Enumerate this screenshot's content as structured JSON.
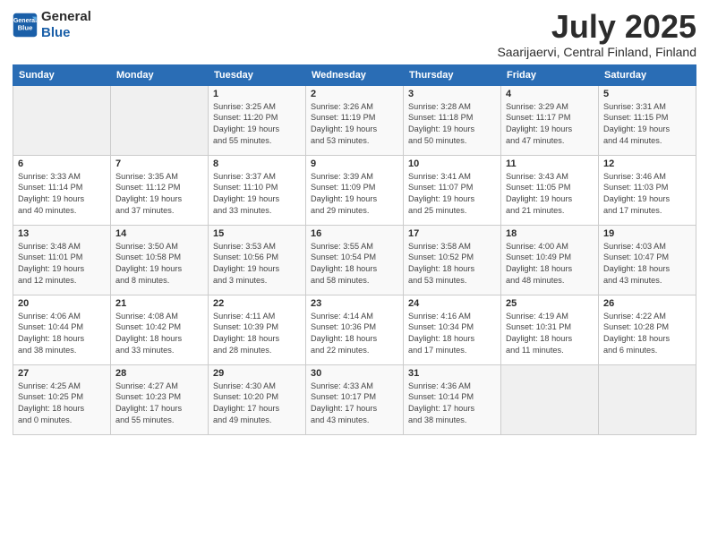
{
  "header": {
    "logo_general": "General",
    "logo_blue": "Blue",
    "month": "July 2025",
    "location": "Saarijaervi, Central Finland, Finland"
  },
  "weekdays": [
    "Sunday",
    "Monday",
    "Tuesday",
    "Wednesday",
    "Thursday",
    "Friday",
    "Saturday"
  ],
  "weeks": [
    [
      {
        "day": "",
        "info": ""
      },
      {
        "day": "",
        "info": ""
      },
      {
        "day": "1",
        "info": "Sunrise: 3:25 AM\nSunset: 11:20 PM\nDaylight: 19 hours\nand 55 minutes."
      },
      {
        "day": "2",
        "info": "Sunrise: 3:26 AM\nSunset: 11:19 PM\nDaylight: 19 hours\nand 53 minutes."
      },
      {
        "day": "3",
        "info": "Sunrise: 3:28 AM\nSunset: 11:18 PM\nDaylight: 19 hours\nand 50 minutes."
      },
      {
        "day": "4",
        "info": "Sunrise: 3:29 AM\nSunset: 11:17 PM\nDaylight: 19 hours\nand 47 minutes."
      },
      {
        "day": "5",
        "info": "Sunrise: 3:31 AM\nSunset: 11:15 PM\nDaylight: 19 hours\nand 44 minutes."
      }
    ],
    [
      {
        "day": "6",
        "info": "Sunrise: 3:33 AM\nSunset: 11:14 PM\nDaylight: 19 hours\nand 40 minutes."
      },
      {
        "day": "7",
        "info": "Sunrise: 3:35 AM\nSunset: 11:12 PM\nDaylight: 19 hours\nand 37 minutes."
      },
      {
        "day": "8",
        "info": "Sunrise: 3:37 AM\nSunset: 11:10 PM\nDaylight: 19 hours\nand 33 minutes."
      },
      {
        "day": "9",
        "info": "Sunrise: 3:39 AM\nSunset: 11:09 PM\nDaylight: 19 hours\nand 29 minutes."
      },
      {
        "day": "10",
        "info": "Sunrise: 3:41 AM\nSunset: 11:07 PM\nDaylight: 19 hours\nand 25 minutes."
      },
      {
        "day": "11",
        "info": "Sunrise: 3:43 AM\nSunset: 11:05 PM\nDaylight: 19 hours\nand 21 minutes."
      },
      {
        "day": "12",
        "info": "Sunrise: 3:46 AM\nSunset: 11:03 PM\nDaylight: 19 hours\nand 17 minutes."
      }
    ],
    [
      {
        "day": "13",
        "info": "Sunrise: 3:48 AM\nSunset: 11:01 PM\nDaylight: 19 hours\nand 12 minutes."
      },
      {
        "day": "14",
        "info": "Sunrise: 3:50 AM\nSunset: 10:58 PM\nDaylight: 19 hours\nand 8 minutes."
      },
      {
        "day": "15",
        "info": "Sunrise: 3:53 AM\nSunset: 10:56 PM\nDaylight: 19 hours\nand 3 minutes."
      },
      {
        "day": "16",
        "info": "Sunrise: 3:55 AM\nSunset: 10:54 PM\nDaylight: 18 hours\nand 58 minutes."
      },
      {
        "day": "17",
        "info": "Sunrise: 3:58 AM\nSunset: 10:52 PM\nDaylight: 18 hours\nand 53 minutes."
      },
      {
        "day": "18",
        "info": "Sunrise: 4:00 AM\nSunset: 10:49 PM\nDaylight: 18 hours\nand 48 minutes."
      },
      {
        "day": "19",
        "info": "Sunrise: 4:03 AM\nSunset: 10:47 PM\nDaylight: 18 hours\nand 43 minutes."
      }
    ],
    [
      {
        "day": "20",
        "info": "Sunrise: 4:06 AM\nSunset: 10:44 PM\nDaylight: 18 hours\nand 38 minutes."
      },
      {
        "day": "21",
        "info": "Sunrise: 4:08 AM\nSunset: 10:42 PM\nDaylight: 18 hours\nand 33 minutes."
      },
      {
        "day": "22",
        "info": "Sunrise: 4:11 AM\nSunset: 10:39 PM\nDaylight: 18 hours\nand 28 minutes."
      },
      {
        "day": "23",
        "info": "Sunrise: 4:14 AM\nSunset: 10:36 PM\nDaylight: 18 hours\nand 22 minutes."
      },
      {
        "day": "24",
        "info": "Sunrise: 4:16 AM\nSunset: 10:34 PM\nDaylight: 18 hours\nand 17 minutes."
      },
      {
        "day": "25",
        "info": "Sunrise: 4:19 AM\nSunset: 10:31 PM\nDaylight: 18 hours\nand 11 minutes."
      },
      {
        "day": "26",
        "info": "Sunrise: 4:22 AM\nSunset: 10:28 PM\nDaylight: 18 hours\nand 6 minutes."
      }
    ],
    [
      {
        "day": "27",
        "info": "Sunrise: 4:25 AM\nSunset: 10:25 PM\nDaylight: 18 hours\nand 0 minutes."
      },
      {
        "day": "28",
        "info": "Sunrise: 4:27 AM\nSunset: 10:23 PM\nDaylight: 17 hours\nand 55 minutes."
      },
      {
        "day": "29",
        "info": "Sunrise: 4:30 AM\nSunset: 10:20 PM\nDaylight: 17 hours\nand 49 minutes."
      },
      {
        "day": "30",
        "info": "Sunrise: 4:33 AM\nSunset: 10:17 PM\nDaylight: 17 hours\nand 43 minutes."
      },
      {
        "day": "31",
        "info": "Sunrise: 4:36 AM\nSunset: 10:14 PM\nDaylight: 17 hours\nand 38 minutes."
      },
      {
        "day": "",
        "info": ""
      },
      {
        "day": "",
        "info": ""
      }
    ]
  ]
}
